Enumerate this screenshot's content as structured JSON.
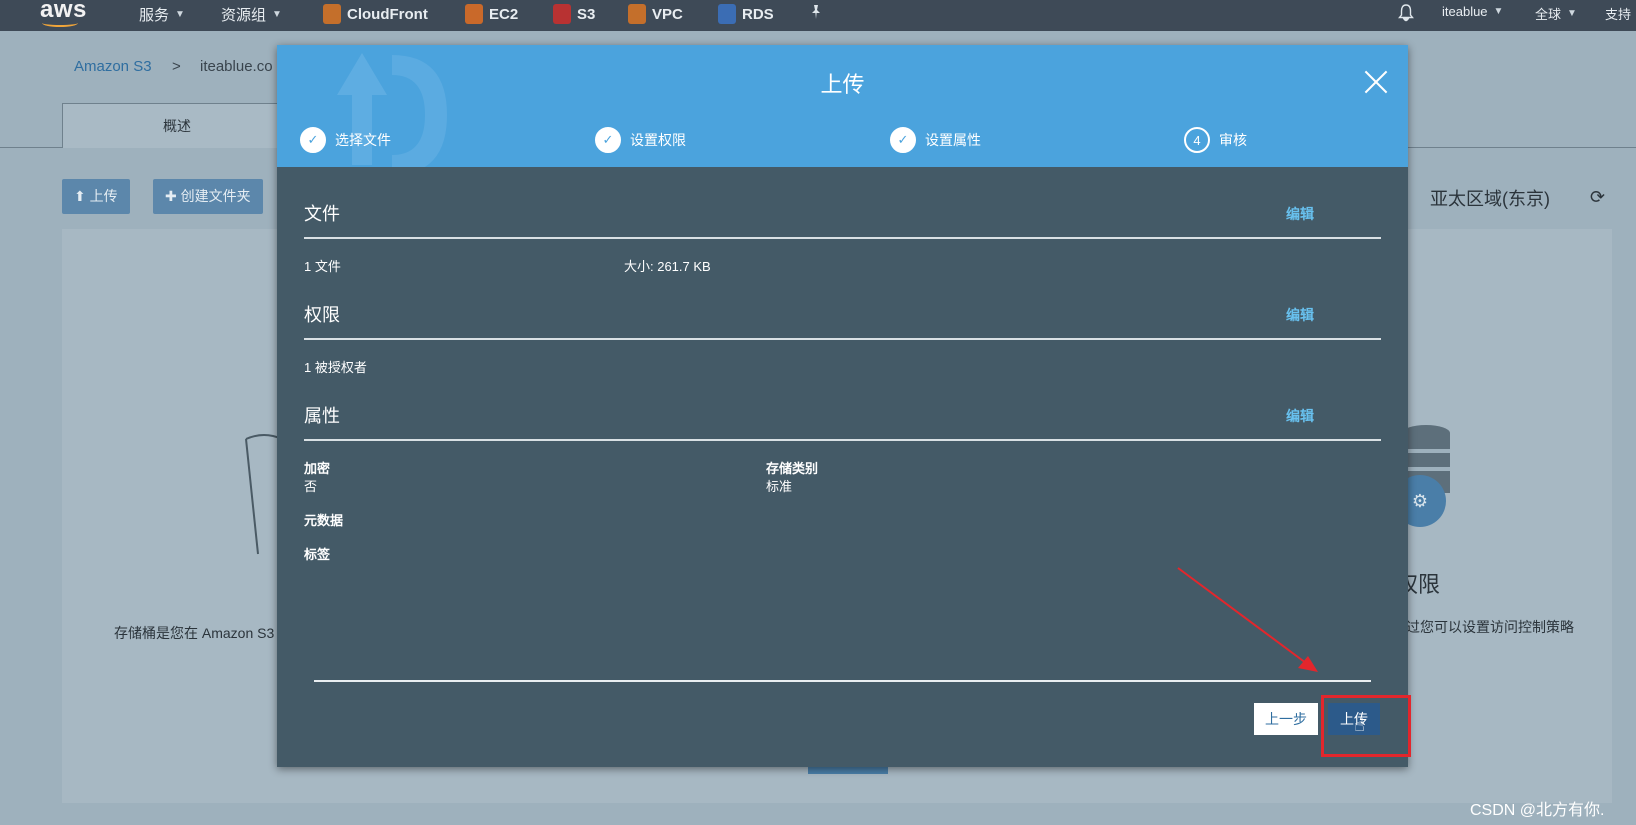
{
  "topnav": {
    "logo": "aws",
    "services": "服务",
    "resource_groups": "资源组",
    "shortcuts": [
      "CloudFront",
      "EC2",
      "S3",
      "VPC",
      "RDS"
    ],
    "account": "iteablue",
    "region": "全球",
    "support": "支持"
  },
  "background": {
    "breadcrumb": {
      "root": "Amazon S3",
      "sep": ">",
      "current": "iteablue.co"
    },
    "tab_overview": "概述",
    "btn_upload": "上传",
    "btn_create_folder": "创建文件夹",
    "region_label": "亚太区域(东京)",
    "left_text": "存储桶是您在 Amazon S3",
    "right_title": "权限",
    "right_text": "过您可以设置访问控制策略"
  },
  "modal": {
    "title": "上传",
    "steps": [
      {
        "label": "选择文件",
        "state": "done"
      },
      {
        "label": "设置权限",
        "state": "done"
      },
      {
        "label": "设置属性",
        "state": "done"
      },
      {
        "label": "审核",
        "number": "4",
        "state": "current"
      }
    ],
    "sections": {
      "files": {
        "title": "文件",
        "edit": "编辑",
        "count": "1 文件",
        "size": "大小: 261.7 KB"
      },
      "permissions": {
        "title": "权限",
        "edit": "编辑",
        "grantees": "1 被授权者"
      },
      "properties": {
        "title": "属性",
        "edit": "编辑",
        "encryption_label": "加密",
        "encryption_value": "否",
        "storage_class_label": "存储类别",
        "storage_class_value": "标准",
        "metadata_label": "元数据",
        "tags_label": "标签"
      }
    },
    "buttons": {
      "prev": "上一步",
      "upload": "上传"
    }
  },
  "watermark": "CSDN @北方有你.",
  "colors": {
    "header": "#4ba3dd",
    "modal_bg": "#445a67",
    "link": "#68c1ef",
    "annotation": "#e3262c"
  }
}
